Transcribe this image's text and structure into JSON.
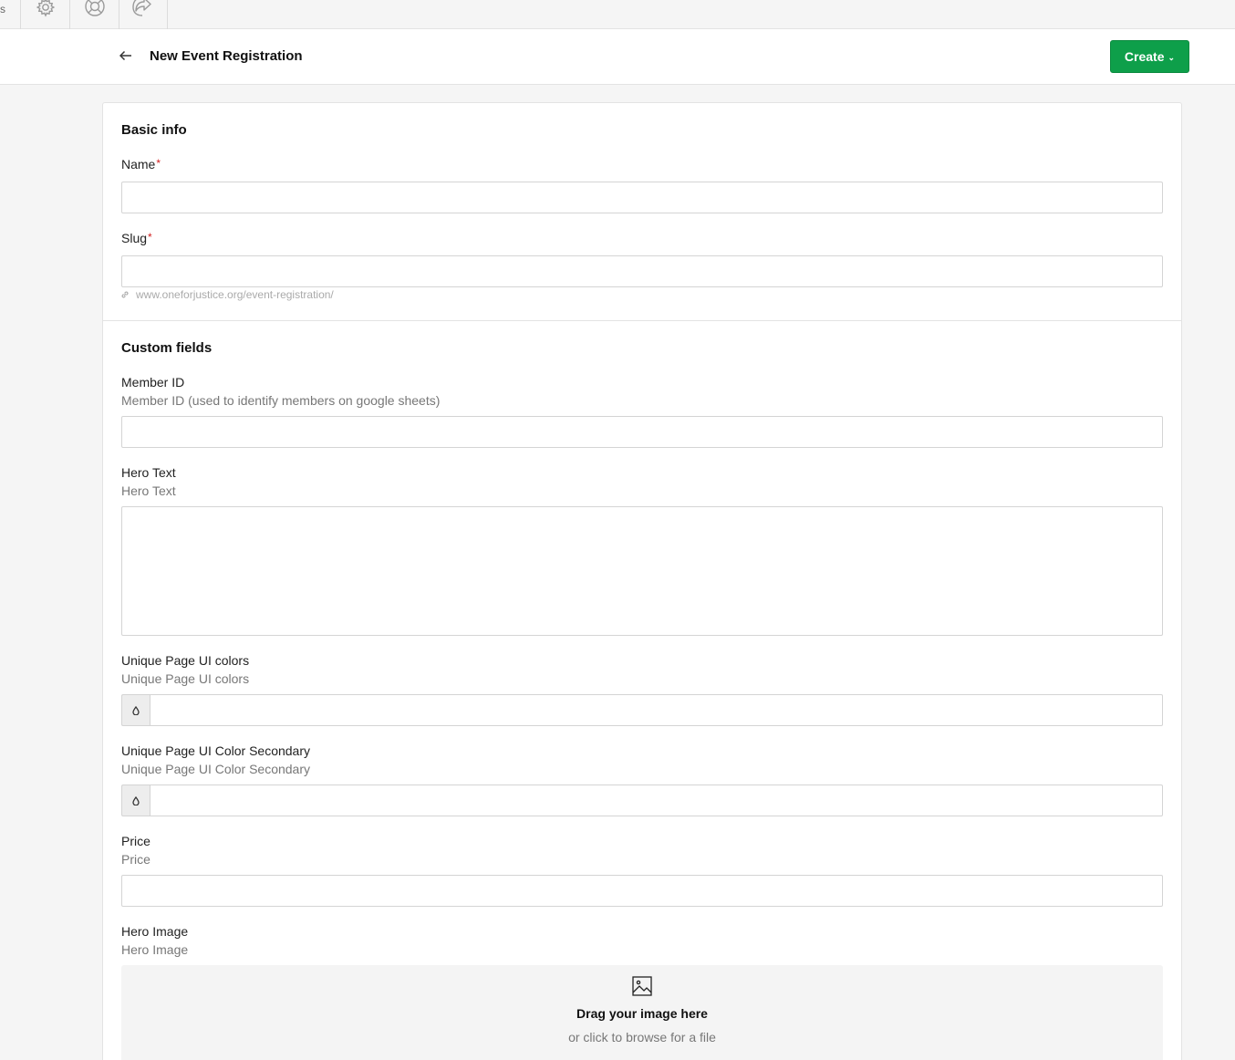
{
  "topbar": {
    "edge_char": "s",
    "icons": [
      "gear-icon",
      "lifebuoy-icon",
      "share-icon"
    ]
  },
  "header": {
    "title": "New Event Registration",
    "create_label": "Create"
  },
  "basic_info": {
    "title": "Basic info",
    "name_label": "Name",
    "slug_label": "Slug",
    "required_mark": "*",
    "slug_url": "www.oneforjustice.org/event-registration/"
  },
  "custom_fields": {
    "title": "Custom fields",
    "member_id": {
      "label": "Member ID",
      "help": "Member ID (used to identify members on google sheets)"
    },
    "hero_text": {
      "label": "Hero Text",
      "help": "Hero Text"
    },
    "ui_colors": {
      "label": "Unique Page UI colors",
      "help": "Unique Page UI colors"
    },
    "ui_color_secondary": {
      "label": "Unique Page UI Color Secondary",
      "help": "Unique Page UI Color Secondary"
    },
    "price": {
      "label": "Price",
      "help": "Price"
    },
    "hero_image": {
      "label": "Hero Image",
      "help": "Hero Image",
      "drop_title": "Drag your image here",
      "drop_sub": "or click to browse for a file"
    }
  },
  "colors": {
    "accent": "#0e9f4a",
    "required": "#d21f1f"
  }
}
